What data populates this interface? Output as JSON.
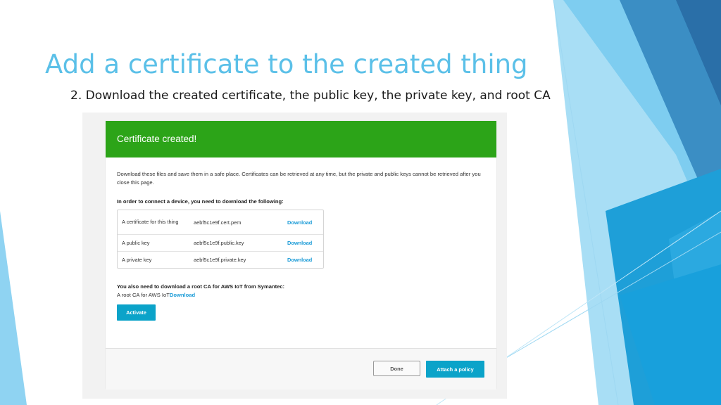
{
  "slide": {
    "title": "Add a certificate to the created thing",
    "subtitle": "2. Download the created certificate, the public key, the private key, and root CA"
  },
  "dialog": {
    "header": "Certificate created!",
    "notice": "Download these files and save them in a safe place. Certificates can be retrieved at any time, but the private and public keys cannot be retrieved after you close this page.",
    "requirement_heading": "In order to connect a device, you need to download the following:",
    "files": [
      {
        "description": "A certificate for this thing",
        "filename": "aebf5c1e9f.cert.pem",
        "action": "Download"
      },
      {
        "description": "A public key",
        "filename": "aebf5c1e9f.public.key",
        "action": "Download"
      },
      {
        "description": "A private key",
        "filename": "aebf5c1e9f.private.key",
        "action": "Download"
      }
    ],
    "root_ca_heading": "You also need to download a root CA for AWS IoT from Symantec:",
    "root_ca_label": "A root CA for AWS IoT",
    "root_ca_link": "Download",
    "activate_label": "Activate",
    "done_label": "Done",
    "attach_policy_label": "Attach a policy"
  },
  "colors": {
    "title": "#5bc0e8",
    "header_green": "#2ca418",
    "primary_button": "#0ba3c9",
    "link": "#1a9bd7"
  }
}
